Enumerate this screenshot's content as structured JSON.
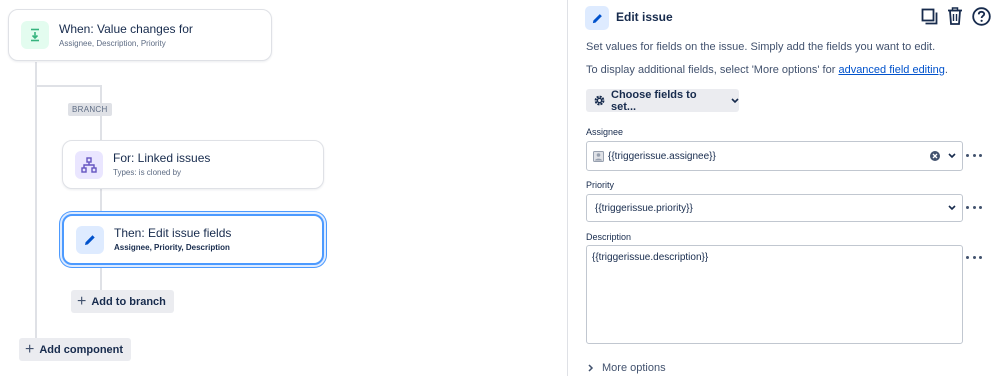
{
  "trigger": {
    "title": "When: Value changes for",
    "subtitle": "Assignee, Description, Priority",
    "icon": "value-change-icon",
    "icon_color": "#36b37e"
  },
  "branch": {
    "tag": "BRANCH",
    "card": {
      "title": "For: Linked issues",
      "subtitle": "Types: is cloned by",
      "icon": "hierarchy-icon",
      "icon_color": "#6554c0"
    },
    "action": {
      "title": "Then: Edit issue fields",
      "subtitle": "Assignee, Priority, Description",
      "icon": "pencil-icon",
      "icon_color": "#0052cc"
    },
    "add_label": "Add to branch"
  },
  "add_component_label": "Add component",
  "panel": {
    "title": "Edit issue",
    "line1": "Set values for fields on the issue. Simply add the fields you want to edit.",
    "line2_prefix": "To display additional fields, select 'More options' for ",
    "line2_link": "advanced field editing",
    "line2_suffix": ".",
    "choose_fields_label": "Choose fields to set...",
    "fields": {
      "assignee": {
        "label": "Assignee",
        "value": "{{triggerissue.assignee}}"
      },
      "priority": {
        "label": "Priority",
        "value": "{{triggerissue.priority}}"
      },
      "description": {
        "label": "Description",
        "value": "{{triggerissue.description}}"
      }
    },
    "more_options_label": "More options"
  },
  "colors": {
    "accent": "#0052cc",
    "selected_border": "#4c9aff",
    "button_bg": "#ebecf0",
    "border": "#dfe1e6"
  }
}
